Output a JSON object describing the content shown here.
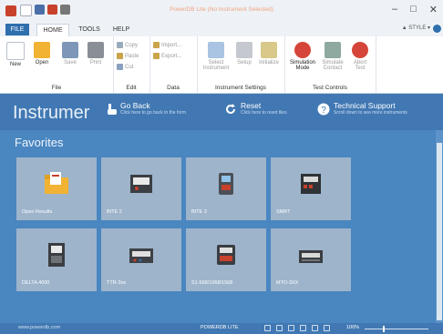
{
  "window": {
    "title": "PowerDB Lite (No Instrument Selected)",
    "minimize": "–",
    "maximize": "□",
    "close": "✕"
  },
  "tabs": {
    "file": "FILE",
    "home": "HOME",
    "tools": "TOOLS",
    "help": "HELP",
    "style": "▲ STYLE ▾"
  },
  "ribbon": {
    "file_group": {
      "label": "File",
      "new": "New",
      "open": "Open",
      "save": "Save",
      "print": "Print"
    },
    "edit_group": {
      "label": "Edit",
      "copy": "Copy",
      "paste": "Paste",
      "cut": "Cut"
    },
    "data_group": {
      "label": "Data",
      "import1": "Import...",
      "import2": "Export..."
    },
    "instrument_group": {
      "label": "Instrument Settings",
      "select": "Select\nInstrument",
      "setup": "Setup",
      "initialize": "Initialize"
    },
    "test_group": {
      "label": "Test Controls",
      "simulation": "Simulation\nMode",
      "simulate_contact": "Simulate\nContact",
      "abort": "Abort\nTest"
    }
  },
  "header": {
    "title": "Instrumer",
    "go_back": "Go Back",
    "go_back_sub": "Click here to go back to the form",
    "reset": "Reset",
    "reset_sub": "Click here to reset tiles",
    "support": "Technical Support",
    "support_sub": "Scroll down to see more instruments"
  },
  "favorites": {
    "title": "Favorites",
    "tiles": [
      {
        "label": "Open Results"
      },
      {
        "label": "BITE 2"
      },
      {
        "label": "BITE 3"
      },
      {
        "label": "SMRT"
      },
      {
        "label": "DELTA 4000"
      },
      {
        "label": "TTR-3xx"
      },
      {
        "label": "S1-568/1068/1568"
      },
      {
        "label": "MTO-3XX"
      }
    ]
  },
  "status": {
    "website": "www.powerdb.com",
    "product": "POWERDB LITE",
    "zoom": "100%"
  },
  "colors": {
    "accent": "#2f6fad",
    "main_bg": "#4a86c0",
    "tile_bg": "#9db4cb"
  }
}
